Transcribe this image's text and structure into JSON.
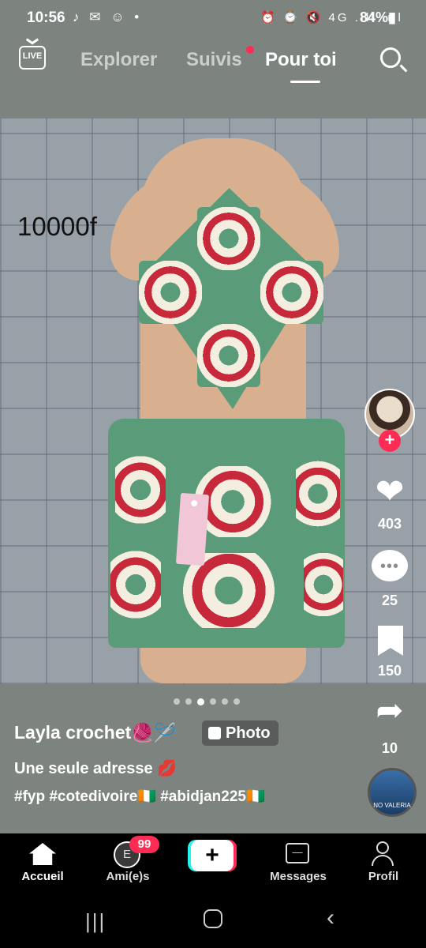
{
  "status_bar": {
    "time": "10:56",
    "left_icons": "♪ ✉ ☺ •",
    "right_icons": "⏰ ⌚ 🔇 4G .ıll .ıll",
    "battery": "84%▮"
  },
  "top_nav": {
    "live_label": "LIVE",
    "tabs": [
      {
        "label": "Explorer"
      },
      {
        "label": "Suivis"
      },
      {
        "label": "Pour toi"
      }
    ]
  },
  "photo": {
    "price_text": "10000f",
    "tag_text": "",
    "carousel": {
      "total": 6,
      "active_index": 2
    }
  },
  "right_rail": {
    "likes": "403",
    "comments": "25",
    "saves": "150",
    "shares": "10",
    "follow_symbol": "+",
    "heart_glyph": "❤",
    "share_glyph": "➦",
    "music_disc_text": "NO VALERIA"
  },
  "caption": {
    "username": "Layla crochet🧶🪡",
    "photo_badge": "Photo",
    "text": "Une seule adresse 💋",
    "hashtags": "#fyp #cotedivoire🇨🇮 #abidjan225🇨🇮"
  },
  "bottom_nav": {
    "items": [
      {
        "label": "Accueil"
      },
      {
        "label": "Ami(e)s",
        "badge": "99",
        "avatar_letter": "E"
      },
      {
        "label": "",
        "plus": "+"
      },
      {
        "label": "Messages"
      },
      {
        "label": "Profil"
      }
    ]
  },
  "system_nav": {
    "recents": "|||",
    "back": "‹"
  },
  "colors": {
    "accent_red": "#fe2c55",
    "accent_cyan": "#25f4ee",
    "crochet_green": "#5a9b79",
    "crochet_red": "#c7283a",
    "crochet_cream": "#f3eee0"
  }
}
